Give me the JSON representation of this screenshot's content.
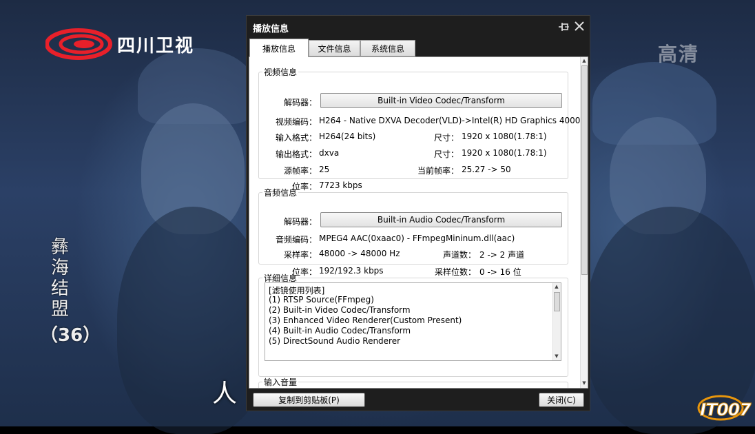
{
  "background": {
    "channel_logo_text": "四川卫视",
    "hd_badge": "高清",
    "drama_title": "彝海结盟",
    "drama_episode": "（36）",
    "subtitle_fragment": "人 ",
    "watermark": "IT007",
    "colors": {
      "logo_red": "#e8202a",
      "watermark_orange": "#e8960c"
    }
  },
  "dialog": {
    "title": "播放信息",
    "icons": {
      "pin": "pin-icon",
      "close": "close-icon"
    },
    "tabs": [
      {
        "label": "播放信息",
        "active": true
      },
      {
        "label": "文件信息",
        "active": false
      },
      {
        "label": "系统信息",
        "active": false
      }
    ],
    "video": {
      "legend": "视频信息",
      "decoder_label": "解码器：",
      "decoder_value": "Built-in Video Codec/Transform",
      "codec_label": "视频编码：",
      "codec_value": "H264 - Native DXVA Decoder(VLD)->Intel(R) HD Graphics 4000",
      "input_label": "输入格式：",
      "input_value": "H264(24 bits)",
      "input_size_label": "尺寸：",
      "input_size_value": "1920 x 1080(1.78:1)",
      "output_label": "输出格式：",
      "output_value": "dxva",
      "output_size_label": "尺寸：",
      "output_size_value": "1920 x 1080(1.78:1)",
      "src_fps_label": "源帧率：",
      "src_fps_value": "25",
      "cur_fps_label": "当前帧率：",
      "cur_fps_value": "25.27 -> 50",
      "bitrate_label": "位率：",
      "bitrate_value": "7723 kbps"
    },
    "audio": {
      "legend": "音频信息",
      "decoder_label": "解码器：",
      "decoder_value": "Built-in Audio Codec/Transform",
      "codec_label": "音频编码：",
      "codec_value": "MPEG4 AAC(0xaac0) - FFmpegMininum.dll(aac)",
      "samplerate_label": "采样率：",
      "samplerate_value": "48000 -> 48000 Hz",
      "channels_label": "声道数：",
      "channels_value": "2 -> 2 声道",
      "bitrate_label": "位率：",
      "bitrate_value": "192/192.3 kbps",
      "bits_label": "采样位数：",
      "bits_value": "0 -> 16 位"
    },
    "detail": {
      "legend": "详细信息",
      "lines": [
        "[滤镜使用列表]",
        "(1) RTSP Source(FFmpeg)",
        "(2) Built-in Video Codec/Transform",
        "(3) Enhanced Video Renderer(Custom Present)",
        "(4) Built-in Audio Codec/Transform",
        "(5) DirectSound Audio Renderer"
      ]
    },
    "volume": {
      "legend": "输入音量"
    },
    "buttons": {
      "copy": "复制到剪贴板(P)",
      "close": "关闭(C)"
    }
  }
}
